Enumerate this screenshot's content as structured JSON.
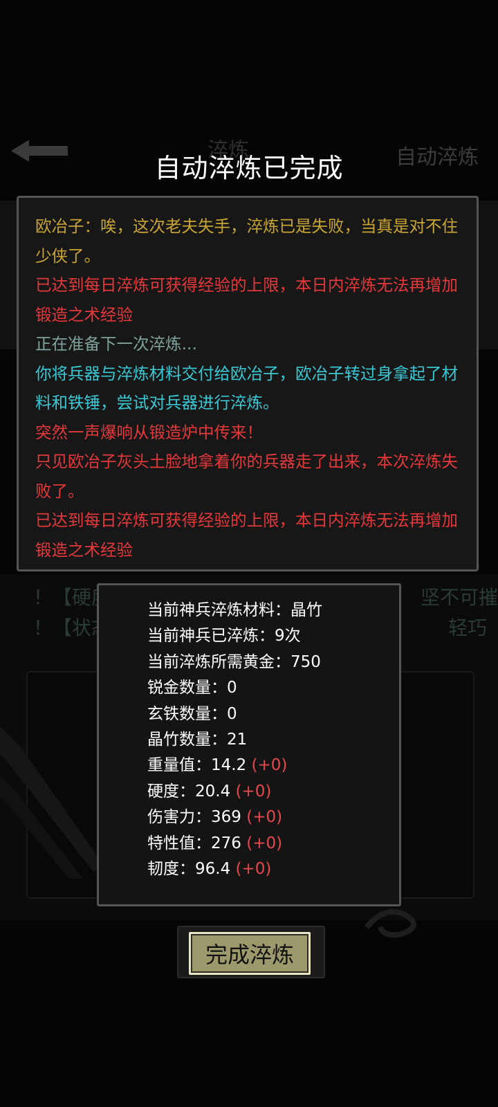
{
  "modal": {
    "title": "自动淬炼已完成",
    "log": [
      {
        "text": "欧冶子：唉，这次老夫失手，淬炼已是失败，当真是对不住少侠了。",
        "color": "#c9a533"
      },
      {
        "text": "已达到每日淬炼可获得经验的上限，本日内淬炼无法再增加锻造之术经验",
        "color": "#e5383b"
      },
      {
        "text": "正在准备下一次淬炼...",
        "color": "#7fa39c"
      },
      {
        "text": "你将兵器与淬炼材料交付给欧冶子，欧冶子转过身拿起了材料和铁锤，尝试对兵器进行淬炼。",
        "color": "#39c9d4"
      },
      {
        "text": "突然一声爆响从锻造炉中传来！",
        "color": "#e5383b"
      },
      {
        "text": "只见欧冶子灰头土脸地拿着你的兵器走了出来，本次淬炼失败了。",
        "color": "#e5383b"
      },
      {
        "text": "已达到每日淬炼可获得经验的上限，本日内淬炼无法再增加锻造之术经验",
        "color": "#e5383b"
      }
    ],
    "stats": [
      {
        "label": "当前神兵淬炼材料：",
        "value": "晶竹",
        "delta": ""
      },
      {
        "label": "当前神兵已淬炼：",
        "value": "9次",
        "delta": ""
      },
      {
        "label": "当前淬炼所需黄金：",
        "value": "750",
        "delta": ""
      },
      {
        "label": "锐金数量：",
        "value": "0",
        "delta": ""
      },
      {
        "label": "玄铁数量：",
        "value": "0",
        "delta": ""
      },
      {
        "label": "晶竹数量：",
        "value": "21",
        "delta": ""
      },
      {
        "label": "重量值：",
        "value": "14.2",
        "delta": "(+0)"
      },
      {
        "label": "硬度：",
        "value": "20.4",
        "delta": "(+0)"
      },
      {
        "label": "伤害力：",
        "value": "369",
        "delta": "(+0)"
      },
      {
        "label": "特性值：",
        "value": "276",
        "delta": "(+0)"
      },
      {
        "label": "韧度：",
        "value": "96.4",
        "delta": "(+0)"
      }
    ],
    "finish_label": "完成淬炼"
  },
  "background": {
    "header_title": "淬炼",
    "auto_label": "自动淬炼",
    "lines": [
      {
        "text": "！【硬度】",
        "tail": "坚不可摧"
      },
      {
        "text": "！【状态】",
        "tail": "轻巧"
      }
    ]
  },
  "colors": {
    "modal_border": "#555555",
    "log_gold": "#c9a533",
    "log_red": "#e5383b",
    "log_grey": "#7fa39c",
    "log_cyan": "#39c9d4",
    "delta_red": "#e5484d",
    "button_fill": "#9c9a6c",
    "button_border": "#e9e6c6"
  }
}
